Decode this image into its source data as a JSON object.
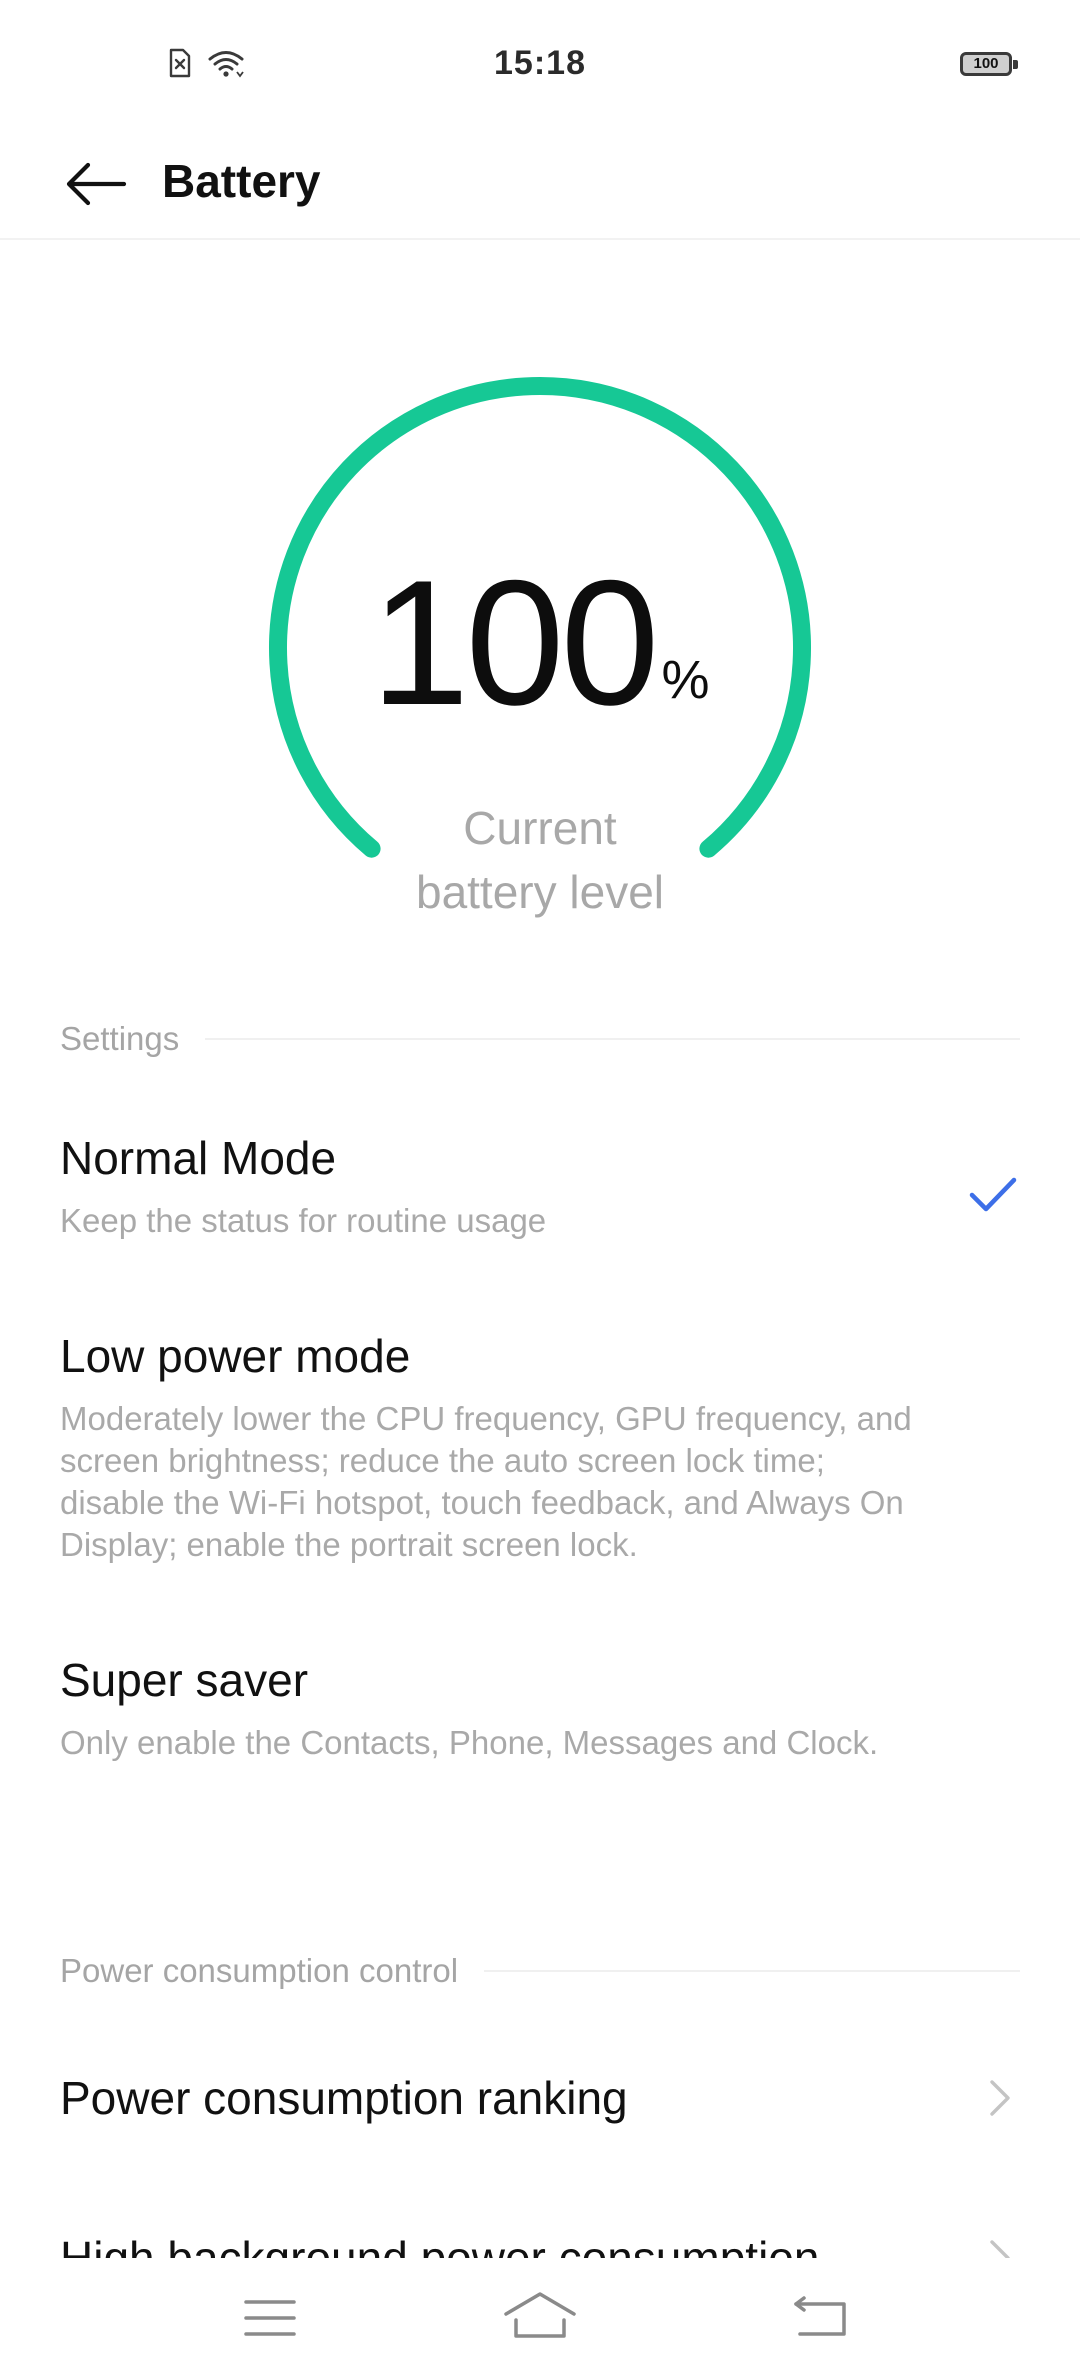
{
  "status_bar": {
    "time": "15:18",
    "battery_level": "100",
    "icons": [
      "no-sim-icon",
      "wifi-icon",
      "battery-icon"
    ]
  },
  "header": {
    "title": "Battery",
    "back_icon": "back-arrow-icon"
  },
  "battery_gauge": {
    "level": "100",
    "unit": "%",
    "caption": "Current\nbattery  level",
    "fill_fraction": 1.0,
    "accent_color": "#16c895"
  },
  "settings_section": {
    "header": "Settings",
    "modes": [
      {
        "title": "Normal Mode",
        "description": "Keep the status for routine usage",
        "selected": true
      },
      {
        "title": "Low power mode",
        "description": "Moderately lower the CPU frequency, GPU frequency, and screen brightness; reduce the auto screen lock time; disable the Wi-Fi hotspot, touch feedback, and Always On Display; enable the portrait screen lock.",
        "selected": false
      },
      {
        "title": "Super saver",
        "description": "Only enable the Contacts, Phone, Messages and Clock.",
        "selected": false
      }
    ],
    "check_color": "#3d6fe8"
  },
  "power_section": {
    "header": "Power consumption control",
    "items": [
      {
        "title": "Power consumption ranking"
      },
      {
        "title": "High background power consumption"
      }
    ]
  },
  "nav_bar": {
    "buttons": [
      "menu-icon",
      "home-icon",
      "back-icon"
    ]
  }
}
